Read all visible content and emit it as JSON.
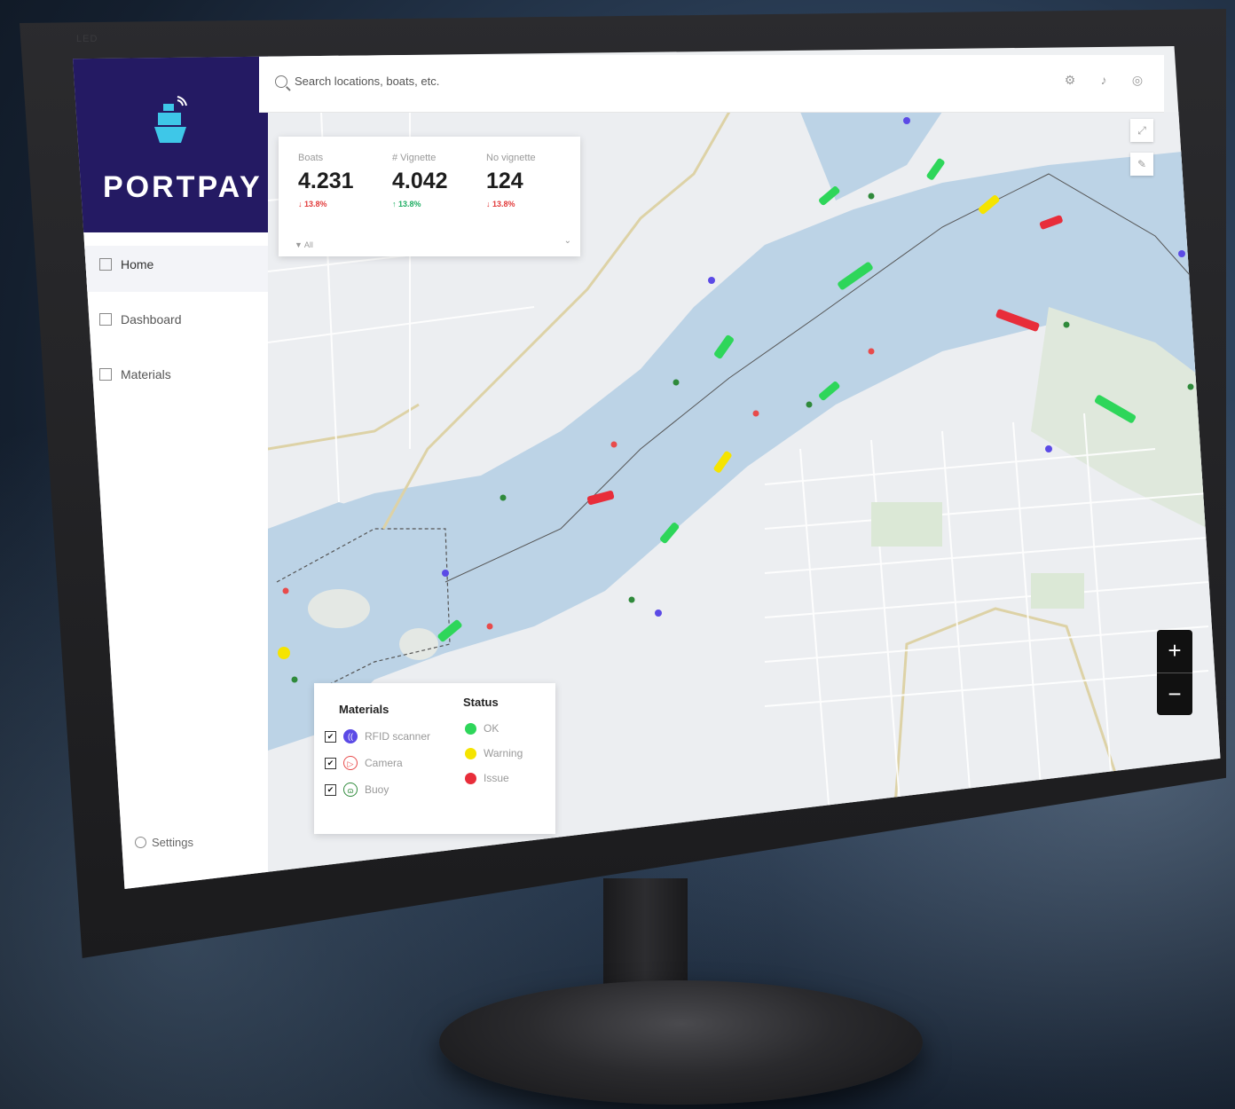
{
  "app": {
    "brand": "PORTPAY"
  },
  "search": {
    "placeholder": "Search locations, boats, etc."
  },
  "sidebar": {
    "items": [
      {
        "label": "Home",
        "icon": "home-icon"
      },
      {
        "label": "Dashboard",
        "icon": "bar-chart-icon"
      },
      {
        "label": "Materials",
        "icon": "document-icon"
      }
    ],
    "settings_label": "Settings"
  },
  "stats": [
    {
      "label": "Boats",
      "value": "4.231",
      "change": "↓ 13.8%",
      "trend": "down"
    },
    {
      "label": "# Vignette",
      "value": "4.042",
      "change": "↑ 13.8%",
      "trend": "up"
    },
    {
      "label": "No vignette",
      "value": "124",
      "change": "↓ 13.8%",
      "trend": "down"
    }
  ],
  "stats_filter": "▼ All",
  "legend": {
    "materials_title": "Materials",
    "materials": [
      {
        "label": "RFID scanner",
        "color": "#5b4ae6",
        "icon": "rfid-icon"
      },
      {
        "label": "Camera",
        "color": "#e84b4b",
        "icon": "camera-icon"
      },
      {
        "label": "Buoy",
        "color": "#2f8a3b",
        "icon": "buoy-icon"
      }
    ],
    "status_title": "Status",
    "statuses": [
      {
        "label": "OK",
        "color": "#2ed65a"
      },
      {
        "label": "Warning",
        "color": "#f5e400"
      },
      {
        "label": "Issue",
        "color": "#e82d3a"
      }
    ]
  },
  "zoom": {
    "in": "+",
    "out": "−"
  },
  "monitor_label": "LED",
  "colors": {
    "brand": "#241a63",
    "water": "#bcd3e6",
    "land": "#eeeff1"
  }
}
